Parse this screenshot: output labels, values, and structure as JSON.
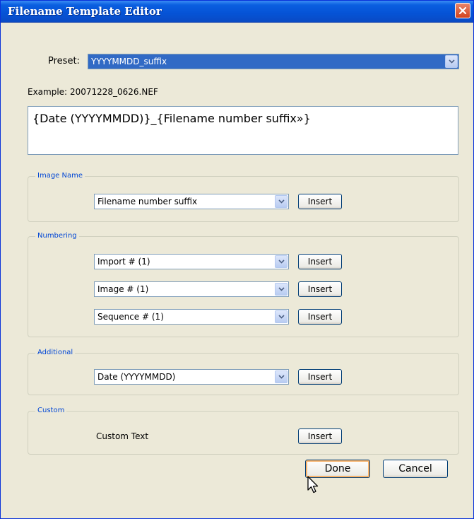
{
  "window": {
    "title": "Filename Template Editor"
  },
  "preset": {
    "label": "Preset:",
    "value": "YYYYMMDD_suffix"
  },
  "example": {
    "label": "Example:",
    "value": "20071228_0626.NEF"
  },
  "template_text": "{Date (YYYYMMDD)}_{Filename number suffix»}",
  "groups": {
    "image_name": {
      "title": "Image Name",
      "rows": [
        {
          "value": "Filename number suffix",
          "button": "Insert"
        }
      ]
    },
    "numbering": {
      "title": "Numbering",
      "rows": [
        {
          "value": "Import # (1)",
          "button": "Insert"
        },
        {
          "value": "Image # (1)",
          "button": "Insert"
        },
        {
          "value": "Sequence # (1)",
          "button": "Insert"
        }
      ]
    },
    "additional": {
      "title": "Additional",
      "rows": [
        {
          "value": "Date (YYYYMMDD)",
          "button": "Insert"
        }
      ]
    },
    "custom": {
      "title": "Custom",
      "label": "Custom Text",
      "button": "Insert"
    }
  },
  "footer": {
    "done": "Done",
    "cancel": "Cancel"
  },
  "icons": {
    "close": "close-icon",
    "dropdown": "chevron-down-icon",
    "cursor": "mouse-pointer-icon"
  },
  "colors": {
    "titlebar": "#0553d6",
    "group_title": "#0046d5",
    "selection": "#316ac5",
    "dialog_bg": "#ece9d8"
  }
}
